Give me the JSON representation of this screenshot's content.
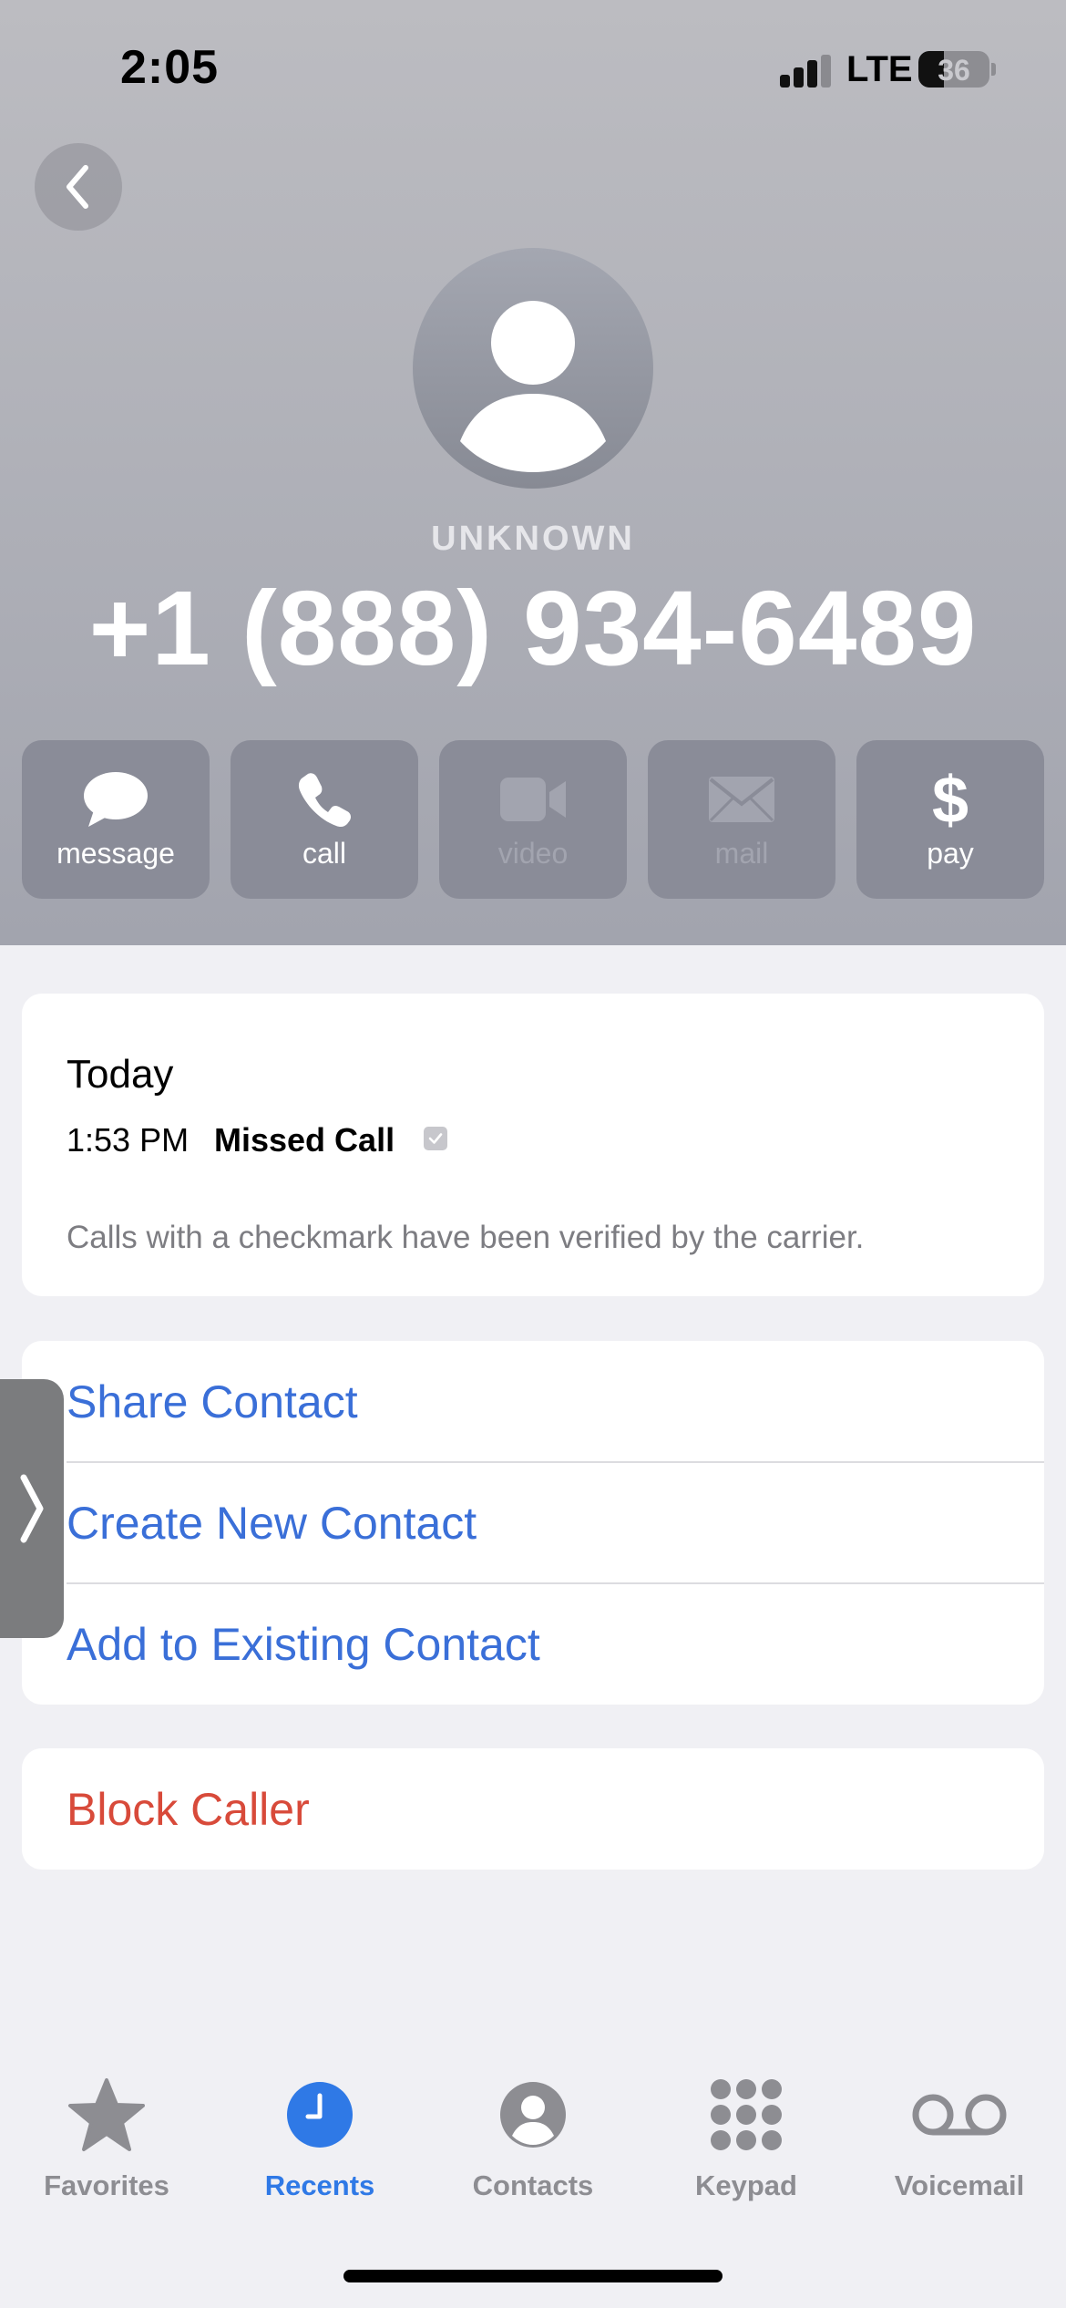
{
  "status_bar": {
    "time": "2:05",
    "network": "LTE",
    "battery": "36",
    "battery_level": 0.36,
    "signal_bars_active": 3
  },
  "header": {
    "back_icon": "chevron-left-icon",
    "caller_label": "UNKNOWN",
    "phone_number": "+1 (888) 934-6489"
  },
  "actions": [
    {
      "label": "message",
      "icon": "message-bubble-icon",
      "enabled": true
    },
    {
      "label": "call",
      "icon": "phone-icon",
      "enabled": true
    },
    {
      "label": "video",
      "icon": "video-camera-icon",
      "enabled": false
    },
    {
      "label": "mail",
      "icon": "envelope-icon",
      "enabled": false
    },
    {
      "label": "pay",
      "icon": "dollar-icon",
      "enabled": true
    }
  ],
  "history": {
    "day": "Today",
    "time": "1:53 PM",
    "type": "Missed Call",
    "note": "Calls with a checkmark have been verified by the carrier."
  },
  "contact_actions": {
    "share": "Share Contact",
    "create": "Create New Contact",
    "add_existing": "Add to Existing Contact"
  },
  "block": {
    "label": "Block Caller"
  },
  "tabs": [
    {
      "label": "Favorites",
      "icon": "star-icon",
      "active": false
    },
    {
      "label": "Recents",
      "icon": "clock-icon",
      "active": true
    },
    {
      "label": "Contacts",
      "icon": "person-circle-icon",
      "active": false
    },
    {
      "label": "Keypad",
      "icon": "keypad-grid-icon",
      "active": false
    },
    {
      "label": "Voicemail",
      "icon": "voicemail-icon",
      "active": false
    }
  ],
  "colors": {
    "link_blue": "#3a6fd8",
    "destructive_red": "#d84a3a",
    "tab_active": "#2f79e6",
    "tab_inactive": "#8d8d92"
  }
}
